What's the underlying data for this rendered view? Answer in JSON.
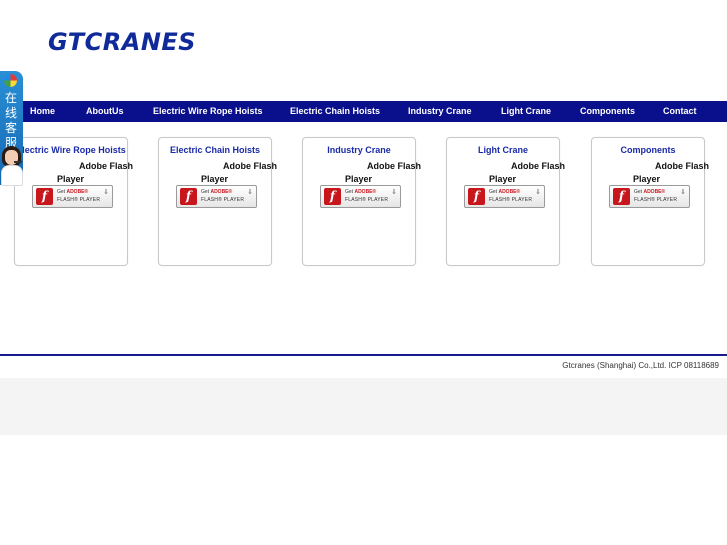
{
  "logo": "GTCRANES",
  "nav": [
    {
      "label": "Home"
    },
    {
      "label": "AboutUs"
    },
    {
      "label": "Electric Wire Rope Hoists"
    },
    {
      "label": "Electric Chain Hoists"
    },
    {
      "label": "Industry Crane"
    },
    {
      "label": "Light Crane"
    },
    {
      "label": "Components"
    },
    {
      "label": "Contact"
    }
  ],
  "chat": {
    "text": "在线客服",
    "icon": "chat-logo-icon"
  },
  "cards": [
    {
      "title": "Electric Wire Rope Hoists",
      "flash_line1": "Adobe Flash",
      "flash_line2": "Player"
    },
    {
      "title": "Electric Chain Hoists",
      "flash_line1": "Adobe Flash",
      "flash_line2": "Player"
    },
    {
      "title": "Industry Crane",
      "flash_line1": "Adobe Flash",
      "flash_line2": "Player"
    },
    {
      "title": "Light Crane",
      "flash_line1": "Adobe Flash",
      "flash_line2": "Player"
    },
    {
      "title": "Components",
      "flash_line1": "Adobe Flash",
      "flash_line2": "Player"
    }
  ],
  "flash_badge": {
    "get": "Get",
    "brand": "ADOBE®",
    "product": "FLASH® PLAYER",
    "glyph": "f",
    "download": "⇓"
  },
  "footer": {
    "text": "Gtcranes (Shanghai) Co.,Ltd. ICP 08118689"
  },
  "colors": {
    "nav_bg": "#0a0f8c",
    "logo": "#102a9a",
    "card_title": "#1a2aa8",
    "flash_red": "#c8161d"
  }
}
